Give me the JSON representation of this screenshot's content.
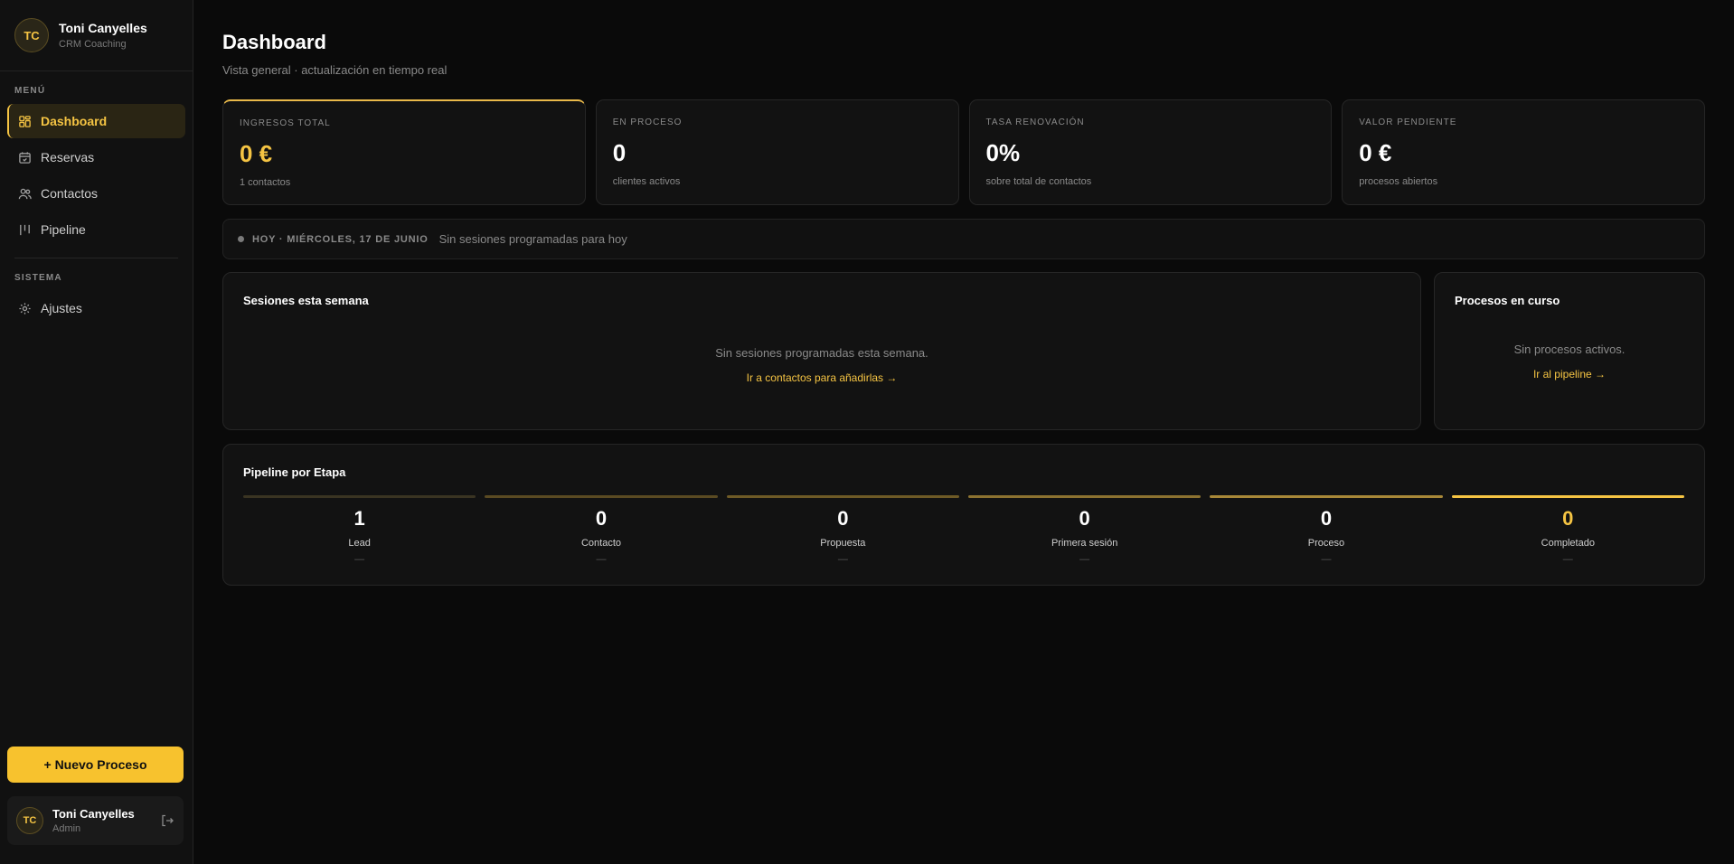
{
  "sidebar": {
    "brand": {
      "initials": "TC",
      "name": "Toni Canyelles",
      "subtitle": "CRM Coaching"
    },
    "menu_label": "MENÚ",
    "menu": [
      {
        "label": "Dashboard",
        "icon": "grid-icon",
        "active": true
      },
      {
        "label": "Reservas",
        "icon": "calendar-icon"
      },
      {
        "label": "Contactos",
        "icon": "users-icon"
      },
      {
        "label": "Pipeline",
        "icon": "pipeline-icon"
      }
    ],
    "system_label": "SISTEMA",
    "system": [
      {
        "label": "Ajustes",
        "icon": "gear-icon"
      }
    ],
    "new_button": "+ Nuevo Proceso",
    "user": {
      "initials": "TC",
      "name": "Toni Canyelles",
      "role": "Admin"
    }
  },
  "header": {
    "title": "Dashboard",
    "subtitle": "Vista general · actualización en tiempo real"
  },
  "stats": [
    {
      "label": "INGRESOS TOTAL",
      "value": "0 €",
      "sub": "1 contactos"
    },
    {
      "label": "EN PROCESO",
      "value": "0",
      "sub": "clientes activos"
    },
    {
      "label": "TASA RENOVACIÓN",
      "value": "0%",
      "sub": "sobre total de contactos"
    },
    {
      "label": "VALOR PENDIENTE",
      "value": "0 €",
      "sub": "procesos abiertos"
    }
  ],
  "today": {
    "label": "HOY · MIÉRCOLES, 17 DE JUNIO",
    "text": "Sin sesiones programadas para hoy"
  },
  "sessions_panel": {
    "title": "Sesiones esta semana",
    "empty": "Sin sesiones programadas esta semana.",
    "link": "Ir a contactos para añadirlas →"
  },
  "processes_panel": {
    "title": "Procesos en curso",
    "empty": "Sin procesos activos.",
    "link": "Ir al pipeline →"
  },
  "pipeline": {
    "title": "Pipeline por Etapa",
    "stages": [
      {
        "count": "1",
        "name": "Lead",
        "extra": "—",
        "bar_color": "#3a3422"
      },
      {
        "count": "0",
        "name": "Contacto",
        "extra": "—",
        "bar_color": "#5a4a22"
      },
      {
        "count": "0",
        "name": "Propuesta",
        "extra": "—",
        "bar_color": "#6e5a26"
      },
      {
        "count": "0",
        "name": "Primera sesión",
        "extra": "—",
        "bar_color": "#8c7230"
      },
      {
        "count": "0",
        "name": "Proceso",
        "extra": "—",
        "bar_color": "#a88838"
      },
      {
        "count": "0",
        "name": "Completado",
        "extra": "—",
        "bar_color": "#f5c443"
      }
    ]
  },
  "colors": {
    "accent": "#f5c443",
    "background": "#0a0a0a",
    "panel": "#121212"
  }
}
